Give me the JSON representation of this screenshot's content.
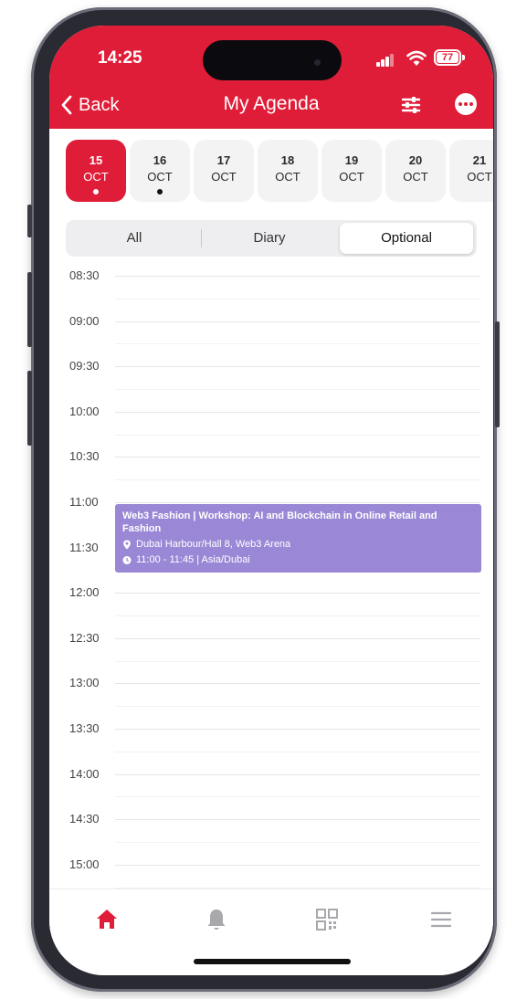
{
  "status_bar": {
    "time": "14:25",
    "battery": "77"
  },
  "nav": {
    "back_label": "Back",
    "title": "My Agenda"
  },
  "dates": [
    {
      "day": "15",
      "month": "OCT",
      "selected": true,
      "has_dot": true
    },
    {
      "day": "16",
      "month": "OCT",
      "selected": false,
      "has_dot": true
    },
    {
      "day": "17",
      "month": "OCT",
      "selected": false,
      "has_dot": false
    },
    {
      "day": "18",
      "month": "OCT",
      "selected": false,
      "has_dot": false
    },
    {
      "day": "19",
      "month": "OCT",
      "selected": false,
      "has_dot": false
    },
    {
      "day": "20",
      "month": "OCT",
      "selected": false,
      "has_dot": false
    },
    {
      "day": "21",
      "month": "OCT",
      "selected": false,
      "has_dot": false
    }
  ],
  "segments": {
    "all": "All",
    "diary": "Diary",
    "optional": "Optional",
    "active": "optional"
  },
  "timeline": {
    "slots": [
      "08:30",
      "09:00",
      "09:30",
      "10:00",
      "10:30",
      "11:00",
      "11:30",
      "12:00",
      "12:30",
      "13:00",
      "13:30",
      "14:00",
      "14:30",
      "15:00"
    ]
  },
  "event": {
    "title": "Web3 Fashion | Workshop: AI and Blockchain in Online Retail and Fashion",
    "location": "Dubai Harbour/Hall 8, Web3 Arena",
    "time": "11:00 - 11:45 | Asia/Dubai",
    "color": "#9a88d6"
  },
  "tabbar": {
    "items": [
      "home-icon",
      "bell-icon",
      "qr-code-icon",
      "menu-icon"
    ],
    "active": "home-icon"
  },
  "colors": {
    "accent": "#e01d38"
  }
}
